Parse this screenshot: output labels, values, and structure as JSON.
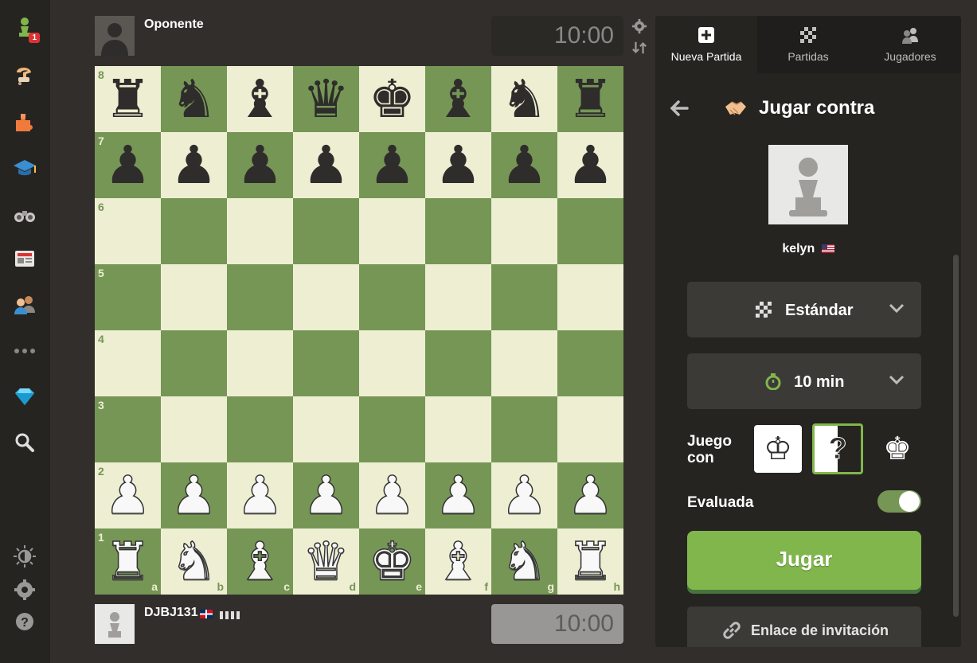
{
  "nav": {
    "items": [
      {
        "name": "play-nav-pawn-icon",
        "badge": "1"
      },
      {
        "name": "puzzles-nav-icon"
      },
      {
        "name": "learn-puzzle-piece-icon"
      },
      {
        "name": "learn-cap-icon"
      },
      {
        "name": "watch-binoculars-icon"
      },
      {
        "name": "news-icon"
      },
      {
        "name": "social-people-icon"
      },
      {
        "name": "more-dots-icon"
      },
      {
        "name": "diamond-icon"
      },
      {
        "name": "search-icon"
      }
    ],
    "bottom": [
      {
        "name": "theme-brightness-icon"
      },
      {
        "name": "settings-gear-icon"
      },
      {
        "name": "help-question-icon"
      }
    ]
  },
  "top_player": {
    "name": "Oponente",
    "clock": "10:00"
  },
  "bottom_player": {
    "name": "DJBJ131",
    "clock": "10:00"
  },
  "board": {
    "ranks": [
      "8",
      "7",
      "6",
      "5",
      "4",
      "3",
      "2",
      "1"
    ],
    "files": [
      "a",
      "b",
      "c",
      "d",
      "e",
      "f",
      "g",
      "h"
    ],
    "rows": [
      [
        "br",
        "bn",
        "bb",
        "bq",
        "bk",
        "bb",
        "bn",
        "br"
      ],
      [
        "bp",
        "bp",
        "bp",
        "bp",
        "bp",
        "bp",
        "bp",
        "bp"
      ],
      [
        "",
        "",
        "",
        "",
        "",
        "",
        "",
        ""
      ],
      [
        "",
        "",
        "",
        "",
        "",
        "",
        "",
        ""
      ],
      [
        "",
        "",
        "",
        "",
        "",
        "",
        "",
        ""
      ],
      [
        "",
        "",
        "",
        "",
        "",
        "",
        "",
        ""
      ],
      [
        "wp",
        "wp",
        "wp",
        "wp",
        "wp",
        "wp",
        "wp",
        "wp"
      ],
      [
        "wr",
        "wn",
        "wb",
        "wq",
        "wk",
        "wb",
        "wn",
        "wr"
      ]
    ],
    "colors": {
      "light": "#eeeed2",
      "dark": "#769656"
    }
  },
  "panel": {
    "tabs": [
      {
        "label": "Nueva Partida",
        "active": true
      },
      {
        "label": "Partidas"
      },
      {
        "label": "Jugadores"
      }
    ],
    "title": "Jugar contra",
    "opponent_name": "kelyn",
    "variant": "Estándar",
    "time_control": "10 min",
    "play_with_label": "Juego con",
    "rated_label": "Evaluada",
    "rated_on": true,
    "play_button": "Jugar",
    "invite_button": "Enlace de invitación",
    "accent": "#81b64c"
  }
}
